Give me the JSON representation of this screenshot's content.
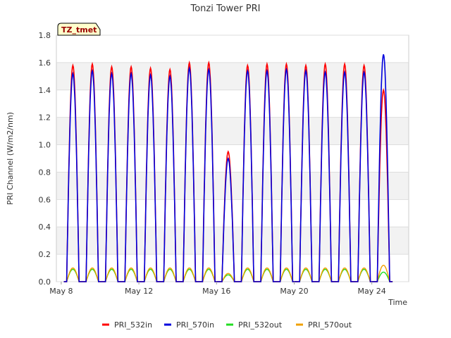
{
  "chart_data": {
    "type": "line",
    "title": "Tonzi Tower PRI",
    "xlabel": "Time",
    "ylabel": "PRI Channel (W/m2/nm)",
    "ylim": [
      0.0,
      1.8
    ],
    "xlim_days": [
      7.75,
      25.9
    ],
    "x_start_date": "May 8",
    "y_ticks": [
      "0.0",
      "0.2",
      "0.4",
      "0.6",
      "0.8",
      "1.0",
      "1.2",
      "1.4",
      "1.6",
      "1.8"
    ],
    "x_ticks": [
      {
        "label": "May 8",
        "day": 8
      },
      {
        "label": "May 12",
        "day": 12
      },
      {
        "label": "May 16",
        "day": 16
      },
      {
        "label": "May 20",
        "day": 20
      },
      {
        "label": "May 24",
        "day": 24
      }
    ],
    "grid": true,
    "legend_position": "bottom",
    "badge": "TZ_tmet",
    "series": [
      {
        "name": "PRI_532in",
        "color": "#ff0000"
      },
      {
        "name": "PRI_570in",
        "color": "#0000dd"
      },
      {
        "name": "PRI_532out",
        "color": "#22dd22"
      },
      {
        "name": "PRI_570out",
        "color": "#f0a000"
      }
    ],
    "daily_peaks": {
      "days": [
        8.6,
        9.6,
        10.6,
        11.6,
        12.6,
        13.6,
        14.6,
        15.6,
        16.6,
        17.6,
        18.6,
        19.6,
        20.6,
        21.6,
        22.6,
        23.6,
        24.6
      ],
      "PRI_532in": [
        1.58,
        1.59,
        1.57,
        1.57,
        1.56,
        1.55,
        1.6,
        1.6,
        0.95,
        1.58,
        1.59,
        1.59,
        1.58,
        1.59,
        1.59,
        1.58,
        1.4
      ],
      "PRI_570in": [
        1.52,
        1.54,
        1.52,
        1.52,
        1.51,
        1.5,
        1.56,
        1.55,
        0.9,
        1.54,
        1.54,
        1.55,
        1.54,
        1.53,
        1.53,
        1.53,
        1.66
      ],
      "PRI_532out": [
        0.09,
        0.09,
        0.09,
        0.09,
        0.09,
        0.09,
        0.09,
        0.09,
        0.05,
        0.09,
        0.09,
        0.09,
        0.09,
        0.09,
        0.09,
        0.09,
        0.07
      ],
      "PRI_570out": [
        0.1,
        0.1,
        0.1,
        0.1,
        0.1,
        0.1,
        0.1,
        0.1,
        0.06,
        0.1,
        0.1,
        0.1,
        0.1,
        0.1,
        0.1,
        0.1,
        0.12
      ]
    }
  }
}
